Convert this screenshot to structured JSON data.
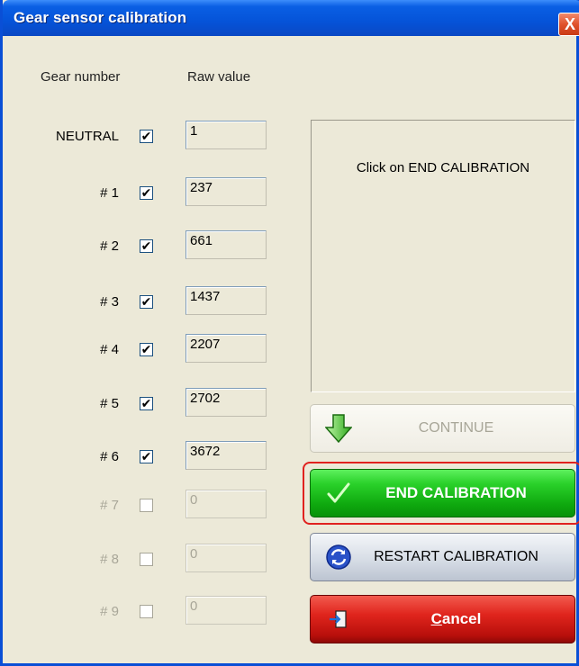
{
  "window": {
    "title": "Gear sensor calibration",
    "close_glyph": "X"
  },
  "headers": {
    "gear_number": "Gear number",
    "raw_value": "Raw value"
  },
  "gears": [
    {
      "label": "NEUTRAL",
      "checked": true,
      "value": "1",
      "enabled": true
    },
    {
      "label": "# 1",
      "checked": true,
      "value": "237",
      "enabled": true
    },
    {
      "label": "# 2",
      "checked": true,
      "value": "661",
      "enabled": true
    },
    {
      "label": "# 3",
      "checked": true,
      "value": "1437",
      "enabled": true
    },
    {
      "label": "# 4",
      "checked": true,
      "value": "2207",
      "enabled": true
    },
    {
      "label": "# 5",
      "checked": true,
      "value": "2702",
      "enabled": true
    },
    {
      "label": "# 6",
      "checked": true,
      "value": "3672",
      "enabled": true
    },
    {
      "label": "# 7",
      "checked": false,
      "value": "0",
      "enabled": false
    },
    {
      "label": "# 8",
      "checked": false,
      "value": "0",
      "enabled": false
    },
    {
      "label": "# 9",
      "checked": false,
      "value": "0",
      "enabled": false
    }
  ],
  "message": "Click on END CALIBRATION",
  "buttons": {
    "continue": "CONTINUE",
    "end_calibration": "END CALIBRATION",
    "restart_calibration": "RESTART CALIBRATION",
    "cancel": "Cancel"
  },
  "icons": {
    "continue": "down-arrow-icon",
    "end_calibration": "checkmark-icon",
    "restart_calibration": "refresh-icon",
    "cancel": "exit-door-icon"
  },
  "colors": {
    "titlebar": "#0553d8",
    "end_button": "#0ea80e",
    "cancel_button": "#e0251d",
    "highlight_outline": "#e0221f"
  }
}
